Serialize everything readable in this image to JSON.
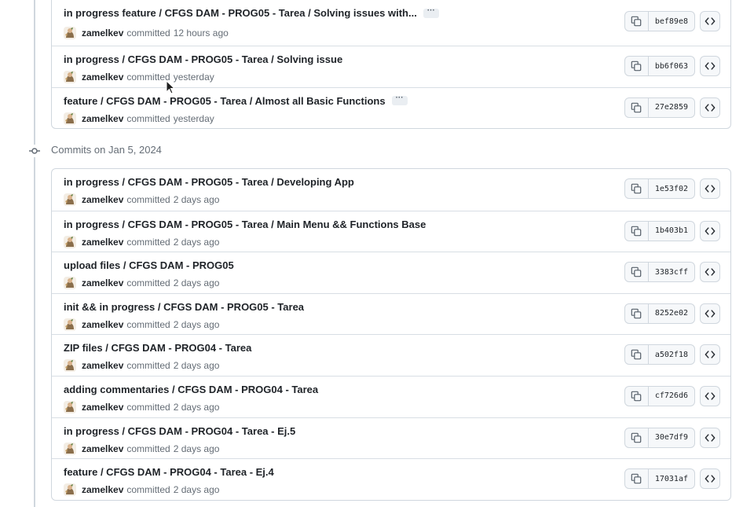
{
  "ui": {
    "more_label": "···",
    "committed_label": "committed",
    "colors": {
      "border": "#d0d7de",
      "muted_text": "#656d76",
      "button_bg": "#f6f8fa"
    },
    "icons": {
      "copy": "copy-icon",
      "browse": "code-icon",
      "timeline_node": "git-commit-icon"
    }
  },
  "groups": [
    {
      "header": "",
      "commits": [
        {
          "message": "in progress feature / CFGS DAM - PROG05 - Tarea / Solving issues with...",
          "has_more": true,
          "author": "zamelkev",
          "time": "12 hours ago",
          "sha": "bef89e8"
        },
        {
          "message": "in progress / CFGS DAM - PROG05 - Tarea / Solving issue",
          "has_more": false,
          "author": "zamelkev",
          "time": "yesterday",
          "sha": "bb6f063"
        },
        {
          "message": "feature / CFGS DAM - PROG05 - Tarea / Almost all Basic Functions",
          "has_more": true,
          "author": "zamelkev",
          "time": "yesterday",
          "sha": "27e2859"
        }
      ]
    },
    {
      "header": "Commits on Jan 5, 2024",
      "commits": [
        {
          "message": "in progress / CFGS DAM - PROG05 - Tarea / Developing App",
          "has_more": false,
          "author": "zamelkev",
          "time": "2 days ago",
          "sha": "1e53f02"
        },
        {
          "message": "in progress / CFGS DAM - PROG05 - Tarea / Main Menu && Functions Base",
          "has_more": false,
          "author": "zamelkev",
          "time": "2 days ago",
          "sha": "1b403b1"
        },
        {
          "message": "upload files / CFGS DAM - PROG05",
          "has_more": false,
          "author": "zamelkev",
          "time": "2 days ago",
          "sha": "3383cff"
        },
        {
          "message": "init && in progress / CFGS DAM - PROG05 - Tarea",
          "has_more": false,
          "author": "zamelkev",
          "time": "2 days ago",
          "sha": "8252e02"
        },
        {
          "message": "ZIP files / CFGS DAM - PROG04 - Tarea",
          "has_more": false,
          "author": "zamelkev",
          "time": "2 days ago",
          "sha": "a502f18"
        },
        {
          "message": "adding commentaries / CFGS DAM - PROG04 - Tarea",
          "has_more": false,
          "author": "zamelkev",
          "time": "2 days ago",
          "sha": "cf726d6"
        },
        {
          "message": "in progress / CFGS DAM - PROG04 - Tarea - Ej.5",
          "has_more": false,
          "author": "zamelkev",
          "time": "2 days ago",
          "sha": "30e7df9"
        },
        {
          "message": "feature / CFGS DAM - PROG04 - Tarea - Ej.4",
          "has_more": false,
          "author": "zamelkev",
          "time": "2 days ago",
          "sha": "17031af"
        }
      ]
    }
  ]
}
